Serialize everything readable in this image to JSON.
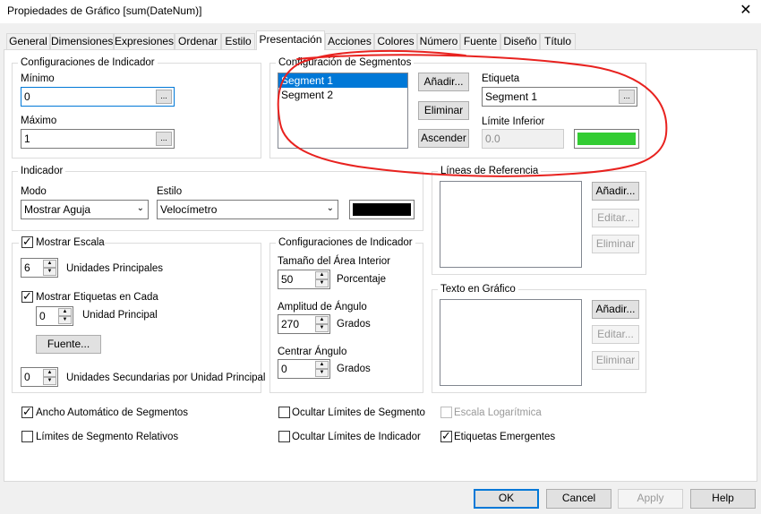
{
  "window": {
    "title": "Propiedades de Gráfico [sum(DateNum)]"
  },
  "tabs": [
    "General",
    "Dimensiones",
    "Expresiones",
    "Ordenar",
    "Estilo",
    "Presentación",
    "Acciones",
    "Colores",
    "Número",
    "Fuente",
    "Diseño",
    "Título"
  ],
  "indicator_settings": {
    "group_label": "Configuraciones de Indicador",
    "min_label": "Mínimo",
    "min_value": "0",
    "max_label": "Máximo",
    "max_value": "1",
    "dots": "..."
  },
  "segments": {
    "group_label": "Configuración de Segmentos",
    "items": [
      "Segment 1",
      "Segment 2"
    ],
    "add_label": "Añadir...",
    "remove_label": "Eliminar",
    "ascend_label": "Ascender",
    "label_label": "Etiqueta",
    "label_value": "Segment 1",
    "lower_limit_label": "Límite Inferior",
    "lower_limit_value": "0.0",
    "segment_color": "#33cc33"
  },
  "indicator": {
    "group_label": "Indicador",
    "mode_label": "Modo",
    "mode_value": "Mostrar Aguja",
    "style_label": "Estilo",
    "style_value": "Velocímetro",
    "needle_color": "#000000"
  },
  "reference_lines": {
    "group_label": "Líneas de Referencia",
    "add_label": "Añadir...",
    "edit_label": "Editar...",
    "remove_label": "Eliminar"
  },
  "scale": {
    "show_scale_label": "Mostrar Escala",
    "major_units_value": "6",
    "major_units_label": "Unidades Principales",
    "show_labels_label": "Mostrar Etiquetas en Cada",
    "label_every_value": "0",
    "label_every_unit": "Unidad Principal",
    "font_button": "Fuente...",
    "minor_units_value": "0",
    "minor_units_label": "Unidades Secundarias por Unidad Principal"
  },
  "indicator_settings2": {
    "group_label": "Configuraciones de Indicador",
    "inner_area_label": "Tamaño del Área Interior",
    "inner_area_value": "50",
    "inner_area_unit": "Porcentaje",
    "angle_span_label": "Amplitud de Ángulo",
    "angle_span_value": "270",
    "angle_span_unit": "Grados",
    "center_angle_label": "Centrar Ángulo",
    "center_angle_value": "0",
    "center_angle_unit": "Grados"
  },
  "chart_text": {
    "group_label": "Texto en Gráfico",
    "add_label": "Añadir...",
    "edit_label": "Editar...",
    "remove_label": "Eliminar"
  },
  "options": {
    "auto_width": "Ancho Automático de Segmentos",
    "relative_limits": "Límites de Segmento Relativos",
    "hide_segment_limits": "Ocultar Límites de Segmento",
    "hide_indicator_limits": "Ocultar Límites de Indicador",
    "log_scale": "Escala Logarítmica",
    "popup_labels": "Etiquetas Emergentes",
    "check_mark": "✓"
  },
  "footer": {
    "ok": "OK",
    "cancel": "Cancel",
    "apply": "Apply",
    "help": "Help"
  },
  "icons": {
    "close": "✕",
    "spin_up": "▲",
    "spin_down": "▼",
    "dropdown": "⌄"
  }
}
